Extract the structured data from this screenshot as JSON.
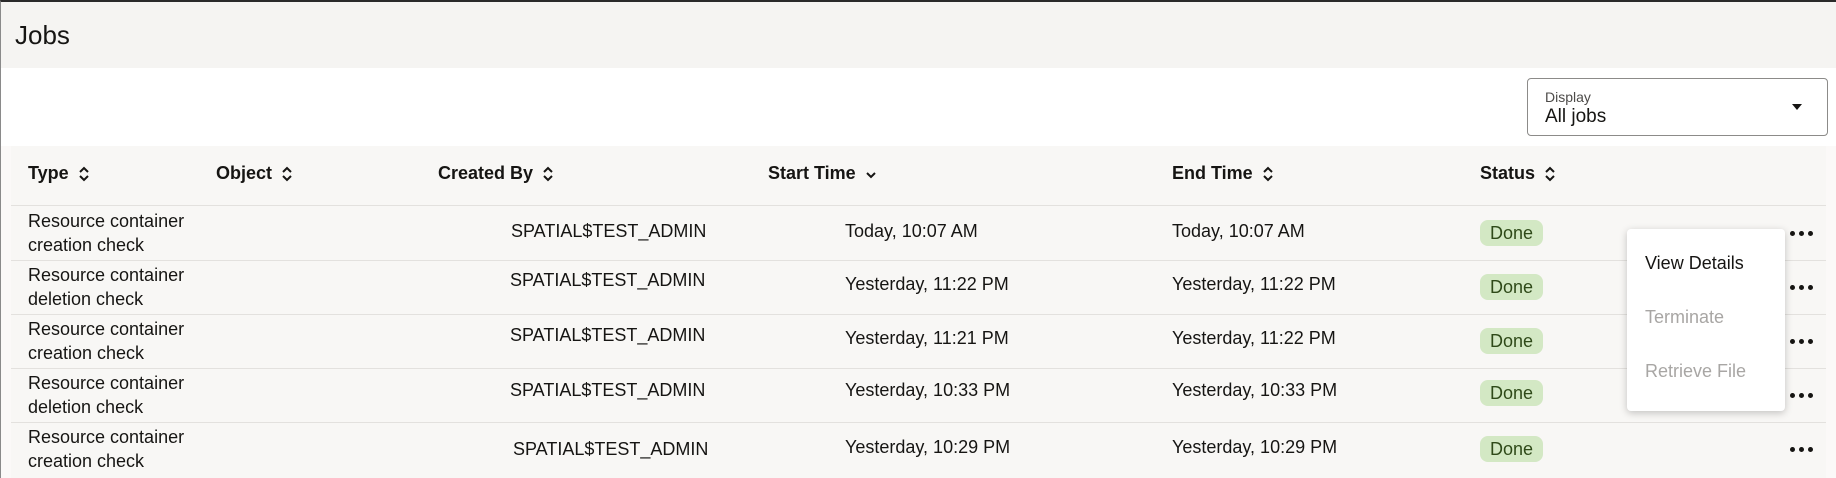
{
  "header": {
    "title": "Jobs"
  },
  "display": {
    "label": "Display",
    "value": "All jobs"
  },
  "table": {
    "columns": [
      {
        "label": "Type",
        "sort": "both"
      },
      {
        "label": "Object",
        "sort": "both"
      },
      {
        "label": "Created By",
        "sort": "both"
      },
      {
        "label": "Start Time",
        "sort": "desc"
      },
      {
        "label": "End Time",
        "sort": "both"
      },
      {
        "label": "Status",
        "sort": "both"
      }
    ],
    "rows": [
      {
        "type": "Resource container creation check",
        "object": "",
        "created_by": "SPATIAL$TEST_ADMIN",
        "start": "Today, 10:07 AM",
        "end": "Today, 10:07 AM",
        "status": "Done"
      },
      {
        "type": "Resource container deletion check",
        "object": "",
        "created_by": "SPATIAL$TEST_ADMIN",
        "start": "Yesterday, 11:22 PM",
        "end": "Yesterday, 11:22 PM",
        "status": "Done"
      },
      {
        "type": "Resource container creation check",
        "object": "",
        "created_by": "SPATIAL$TEST_ADMIN",
        "start": "Yesterday, 11:21 PM",
        "end": "Yesterday, 11:22 PM",
        "status": "Done"
      },
      {
        "type": "Resource container deletion check",
        "object": "",
        "created_by": "SPATIAL$TEST_ADMIN",
        "start": "Yesterday, 10:33 PM",
        "end": "Yesterday, 10:33 PM",
        "status": "Done"
      },
      {
        "type": "Resource container creation check",
        "object": "",
        "created_by": "SPATIAL$TEST_ADMIN",
        "start": "Yesterday, 10:29 PM",
        "end": "Yesterday, 10:29 PM",
        "status": "Done"
      }
    ]
  },
  "context_menu": {
    "items": [
      {
        "label": "View Details",
        "enabled": true
      },
      {
        "label": "Terminate",
        "enabled": false
      },
      {
        "label": "Retrieve File",
        "enabled": false
      }
    ]
  },
  "colors": {
    "status_done_bg": "#d3e8c4",
    "status_done_text": "#2f4a19",
    "disabled_text": "#a8a6a4"
  },
  "icons": {
    "sort": "sort-updown-icon",
    "sort_desc": "chevron-down-icon",
    "more": "more-horizontal-icon",
    "dropdown": "caret-down-icon",
    "cursor": "mouse-pointer-icon"
  }
}
